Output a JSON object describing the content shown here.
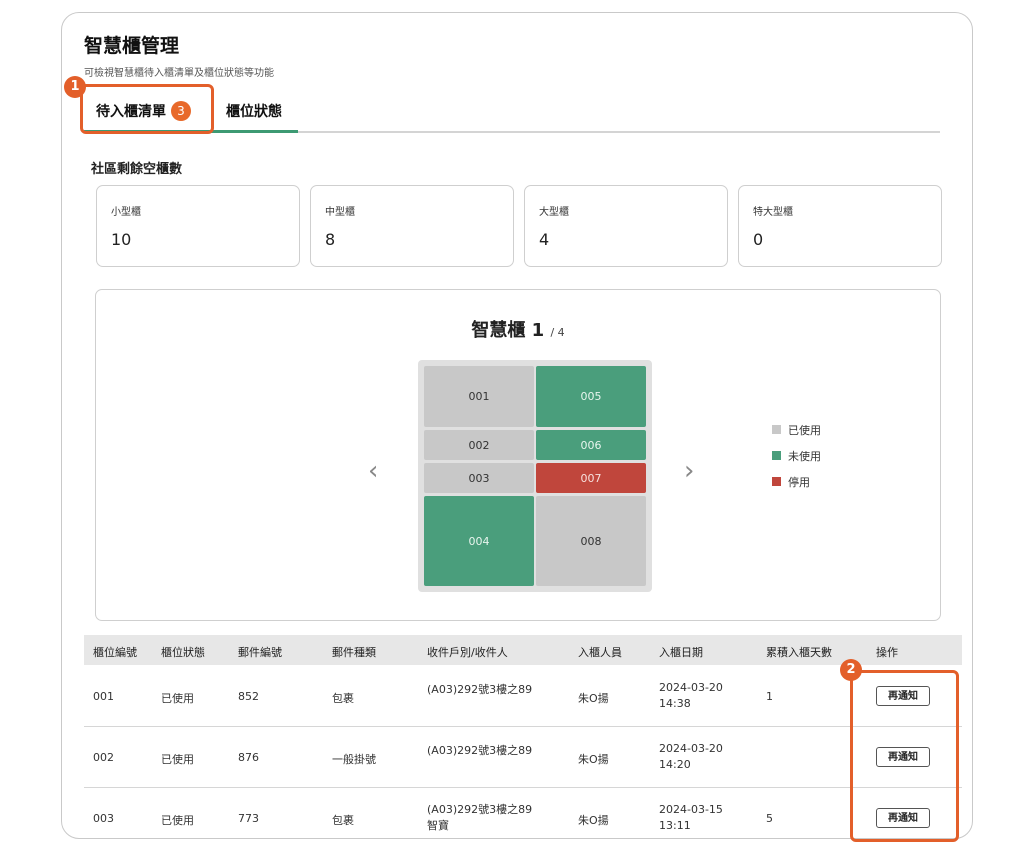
{
  "header": {
    "title": "智慧櫃管理",
    "subtitle": "可檢視智慧櫃待入櫃清單及櫃位狀態等功能"
  },
  "tabs": [
    {
      "label": "待入櫃清單",
      "badge": "3"
    },
    {
      "label": "櫃位狀態"
    }
  ],
  "annotations": [
    "1",
    "2"
  ],
  "stats": {
    "section_label": "社區剩餘空櫃數",
    "items": [
      {
        "label": "小型櫃",
        "value": "10"
      },
      {
        "label": "中型櫃",
        "value": "8"
      },
      {
        "label": "大型櫃",
        "value": "4"
      },
      {
        "label": "特大型櫃",
        "value": "0"
      }
    ]
  },
  "cabinet": {
    "title": "智慧櫃 1",
    "page": "/ 4",
    "prev_icon": "‹",
    "next_icon": "›",
    "cells": [
      {
        "id": "001",
        "status": "used"
      },
      {
        "id": "002",
        "status": "used"
      },
      {
        "id": "003",
        "status": "used"
      },
      {
        "id": "004",
        "status": "free"
      },
      {
        "id": "005",
        "status": "free"
      },
      {
        "id": "006",
        "status": "free"
      },
      {
        "id": "007",
        "status": "disabled"
      },
      {
        "id": "008",
        "status": "used"
      }
    ],
    "legend": [
      {
        "label": "已使用",
        "color": "#c8c8c8"
      },
      {
        "label": "未使用",
        "color": "#4a9e7c"
      },
      {
        "label": "停用",
        "color": "#c0463c"
      }
    ]
  },
  "table": {
    "headers": [
      "櫃位編號",
      "櫃位狀態",
      "郵件編號",
      "郵件種類",
      "收件戶別/收件人",
      "入櫃人員",
      "入櫃日期",
      "累積入櫃天數",
      "操作"
    ],
    "rows": [
      {
        "cell": "001",
        "status": "已使用",
        "mail_no": "852",
        "type": "包裹",
        "recipient": "(A03)292號3樓之89",
        "recipient2": "",
        "staff": "朱O揚",
        "date": "2024-03-20",
        "time": "14:38",
        "days": "1",
        "action": "再通知"
      },
      {
        "cell": "002",
        "status": "已使用",
        "mail_no": "876",
        "type": "一般掛號",
        "recipient": "(A03)292號3樓之89",
        "recipient2": "",
        "staff": "朱O揚",
        "date": "2024-03-20",
        "time": "14:20",
        "days": "",
        "action": "再通知"
      },
      {
        "cell": "003",
        "status": "已使用",
        "mail_no": "773",
        "type": "包裹",
        "recipient": "(A03)292號3樓之89",
        "recipient2": "智寶",
        "staff": "朱O揚",
        "date": "2024-03-15",
        "time": "13:11",
        "days": "5",
        "action": "再通知"
      }
    ]
  },
  "colors": {
    "accent": "#3d9a73",
    "badge": "#e8692a",
    "annotation": "#e35f2a"
  }
}
